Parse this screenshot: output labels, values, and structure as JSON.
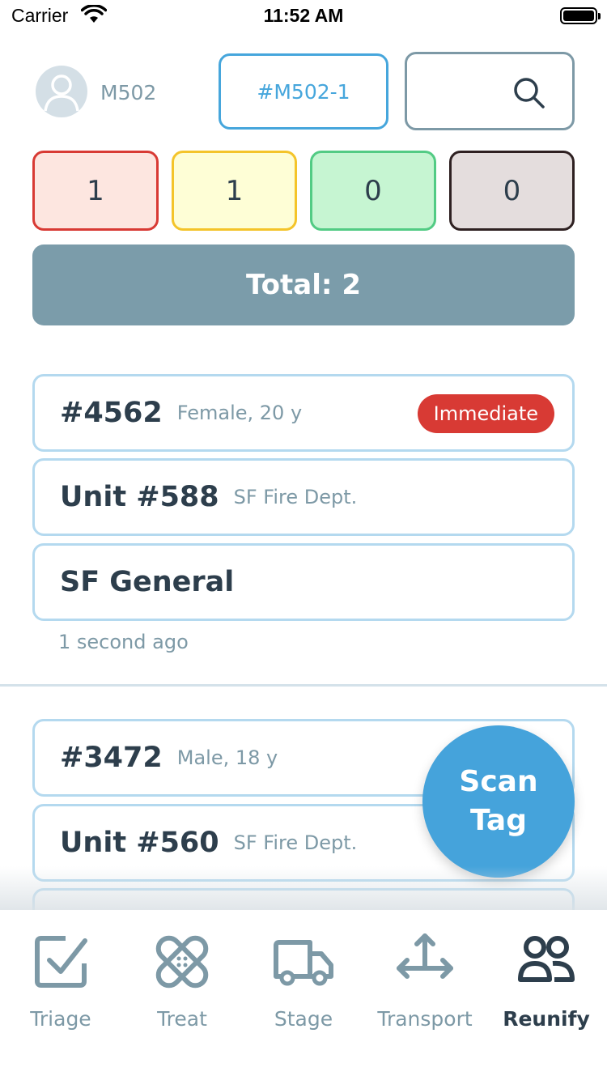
{
  "status_bar": {
    "carrier": "Carrier",
    "time": "11:52 AM"
  },
  "header": {
    "user_id": "M502",
    "unit_button": "#M502-1"
  },
  "counters": {
    "immediate": "1",
    "delayed": "1",
    "minor": "0",
    "expectant": "0"
  },
  "colors": {
    "immediate": "#d83a34",
    "delayed": "#f4c42a",
    "minor": "#52cb84",
    "expectant": "#2e2021",
    "accent": "#45a3db",
    "muted": "#7b9caa"
  },
  "total_label": "Total: 2",
  "patients": [
    {
      "tag": "#4562",
      "info": "Female, 20 y",
      "priority": "Immediate",
      "unit": "Unit #588",
      "agency": "SF Fire Dept.",
      "hospital": "SF General",
      "updated": "1 second ago"
    },
    {
      "tag": "#3472",
      "info": "Male, 18 y",
      "unit": "Unit #560",
      "agency": "SF Fire Dept."
    }
  ],
  "scan_button": {
    "line1": "Scan",
    "line2": "Tag"
  },
  "tabs": [
    {
      "label": "Triage",
      "icon": "checkbox-icon"
    },
    {
      "label": "Treat",
      "icon": "bandage-icon"
    },
    {
      "label": "Stage",
      "icon": "truck-icon"
    },
    {
      "label": "Transport",
      "icon": "arrows-icon"
    },
    {
      "label": "Reunify",
      "icon": "people-icon",
      "active": true
    }
  ]
}
